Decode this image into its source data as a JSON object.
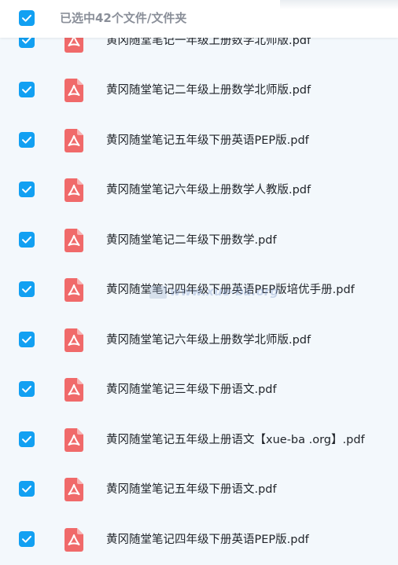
{
  "header": {
    "selected_label": "已选中42个文件/文件夹"
  },
  "files": [
    {
      "name": "黄冈随堂笔记一年级上册数学北师版.pdf"
    },
    {
      "name": "黄冈随堂笔记二年级上册数学北师版.pdf"
    },
    {
      "name": "黄冈随堂笔记五年级下册英语PEP版.pdf"
    },
    {
      "name": "黄冈随堂笔记六年级上册数学人教版.pdf"
    },
    {
      "name": "黄冈随堂笔记二年级下册数学.pdf"
    },
    {
      "name": "黄冈随堂笔记四年级下册英语PEP版培优手册.pdf"
    },
    {
      "name": "黄冈随堂笔记六年级上册数学北师版.pdf"
    },
    {
      "name": "黄冈随堂笔记三年级下册语文.pdf"
    },
    {
      "name": "黄冈随堂笔记五年级上册语文【xue-ba .org】.pdf"
    },
    {
      "name": "黄冈随堂笔记五年级下册语文.pdf"
    },
    {
      "name": "黄冈随堂笔记四年级下册英语PEP版.pdf"
    }
  ],
  "watermark": "www.xue-ba.org",
  "colors": {
    "checkbox": "#12a0f2",
    "pdf_icon": "#f06a6a",
    "background": "#f3f8fc"
  }
}
